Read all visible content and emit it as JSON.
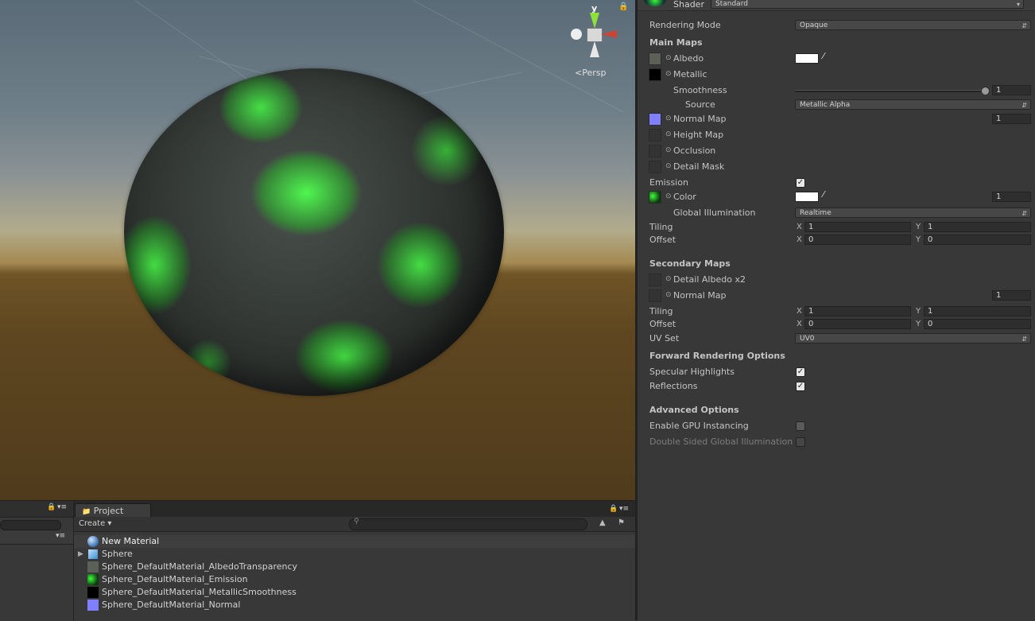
{
  "scene": {
    "persp_label": "Persp",
    "gizmo_axis_label": "y"
  },
  "project": {
    "tab_label": "Project",
    "create_label": "Create",
    "search_placeholder": "",
    "items": [
      {
        "name": "New Material",
        "icon": "material-sphere-icon",
        "selected": true
      },
      {
        "name": "Sphere",
        "icon": "mesh-cube-icon",
        "selected": false
      },
      {
        "name": "Sphere_DefaultMaterial_AlbedoTransparency",
        "icon": "texture-gray-icon",
        "selected": false
      },
      {
        "name": "Sphere_DefaultMaterial_Emission",
        "icon": "texture-green-icon",
        "selected": false
      },
      {
        "name": "Sphere_DefaultMaterial_MetallicSmoothness",
        "icon": "texture-black-icon",
        "selected": false
      },
      {
        "name": "Sphere_DefaultMaterial_Normal",
        "icon": "texture-purple-icon",
        "selected": false
      }
    ]
  },
  "inspector": {
    "shader_label": "Shader",
    "shader_value": "Standard",
    "rendering_mode_label": "Rendering Mode",
    "rendering_mode_value": "Opaque",
    "main_maps_header": "Main Maps",
    "albedo_label": "Albedo",
    "metallic_label": "Metallic",
    "smoothness_label": "Smoothness",
    "smoothness_value": "1",
    "source_label": "Source",
    "source_value": "Metallic Alpha",
    "normal_map_label": "Normal Map",
    "normal_map_value": "1",
    "height_map_label": "Height Map",
    "occlusion_label": "Occlusion",
    "detail_mask_label": "Detail Mask",
    "emission_label": "Emission",
    "emission_checked": true,
    "color_label": "Color",
    "color_value": "1",
    "gi_label": "Global Illumination",
    "gi_value": "Realtime",
    "tiling_label": "Tiling",
    "offset_label": "Offset",
    "axis_x": "X",
    "axis_y": "Y",
    "main_tiling_x": "1",
    "main_tiling_y": "1",
    "main_offset_x": "0",
    "main_offset_y": "0",
    "secondary_maps_header": "Secondary Maps",
    "detail_albedo_label": "Detail Albedo x2",
    "sec_normal_map_label": "Normal Map",
    "sec_normal_map_value": "1",
    "sec_tiling_label": "Tiling",
    "sec_offset_label": "Offset",
    "sec_tiling_x": "1",
    "sec_tiling_y": "1",
    "sec_offset_x": "0",
    "sec_offset_y": "0",
    "uv_set_label": "UV Set",
    "uv_set_value": "UV0",
    "forward_header": "Forward Rendering Options",
    "specular_label": "Specular Highlights",
    "reflections_label": "Reflections",
    "advanced_header": "Advanced Options",
    "gpu_instancing_label": "Enable GPU Instancing",
    "double_sided_label": "Double Sided Global Illumination"
  },
  "colors": {
    "albedo_swatch": "#5b6058",
    "metallic_swatch": "#000000",
    "normal_swatch": "#8080ff",
    "emission_green": "#3cff3c"
  }
}
